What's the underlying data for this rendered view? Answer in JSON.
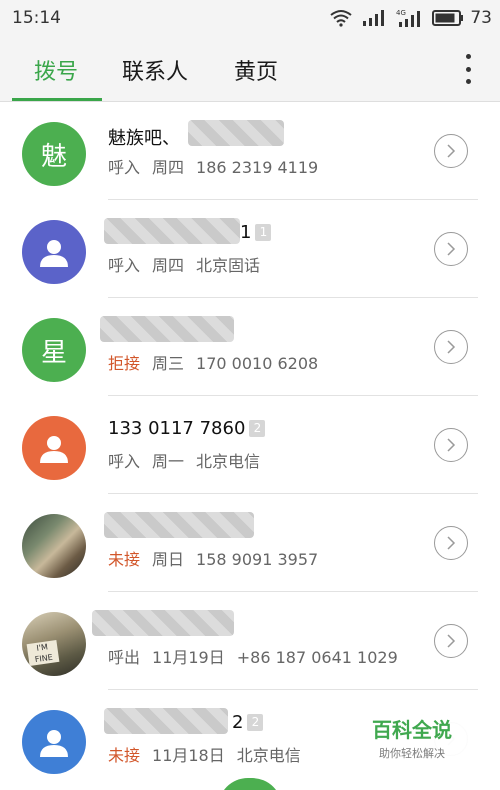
{
  "status_bar": {
    "time": "15:14",
    "network_label": "4G",
    "battery_level": "73"
  },
  "tabs": [
    {
      "label": "拨号",
      "active": true
    },
    {
      "label": "联系人",
      "active": false
    },
    {
      "label": "黄页",
      "active": false
    }
  ],
  "calls": [
    {
      "avatar_text": "魅",
      "avatar_color": "#4caf50",
      "name": "魅族吧、",
      "count": "",
      "type": "呼入",
      "when": "周四",
      "detail": "186 2319 4119",
      "missed": false
    },
    {
      "avatar_text": "",
      "avatar_color": "#5b63c9",
      "name": "1",
      "count": "1",
      "type": "呼入",
      "when": "周四",
      "detail": "北京固话",
      "missed": false
    },
    {
      "avatar_text": "星",
      "avatar_color": "#4caf50",
      "name": "",
      "count": "",
      "type": "拒接",
      "when": "周三",
      "detail": "170 0010 6208",
      "missed": true
    },
    {
      "avatar_text": "",
      "avatar_color": "#e8693e",
      "name": "133 0117 7860",
      "count": "2",
      "type": "呼入",
      "when": "周一",
      "detail": "北京电信",
      "missed": false
    },
    {
      "avatar_text": "",
      "avatar_color": "",
      "name": "",
      "count": "",
      "type": "未接",
      "when": "周日",
      "detail": "158 9091 3957",
      "missed": true
    },
    {
      "avatar_text": "",
      "avatar_color": "",
      "name": "",
      "count": "",
      "type": "呼出",
      "when": "11月19日",
      "detail": "+86 187 0641 1029",
      "missed": false
    },
    {
      "avatar_text": "",
      "avatar_color": "#3f7fd6",
      "name": "2",
      "count": "2",
      "type": "未接",
      "when": "11月18日",
      "detail": "北京电信",
      "missed": true
    }
  ],
  "photo_caption": "I'M FINE",
  "watermark": {
    "title": "百科全说",
    "subtitle": "助你轻松解决"
  },
  "colors": {
    "accent": "#3aa64a",
    "missed": "#d2562a"
  }
}
